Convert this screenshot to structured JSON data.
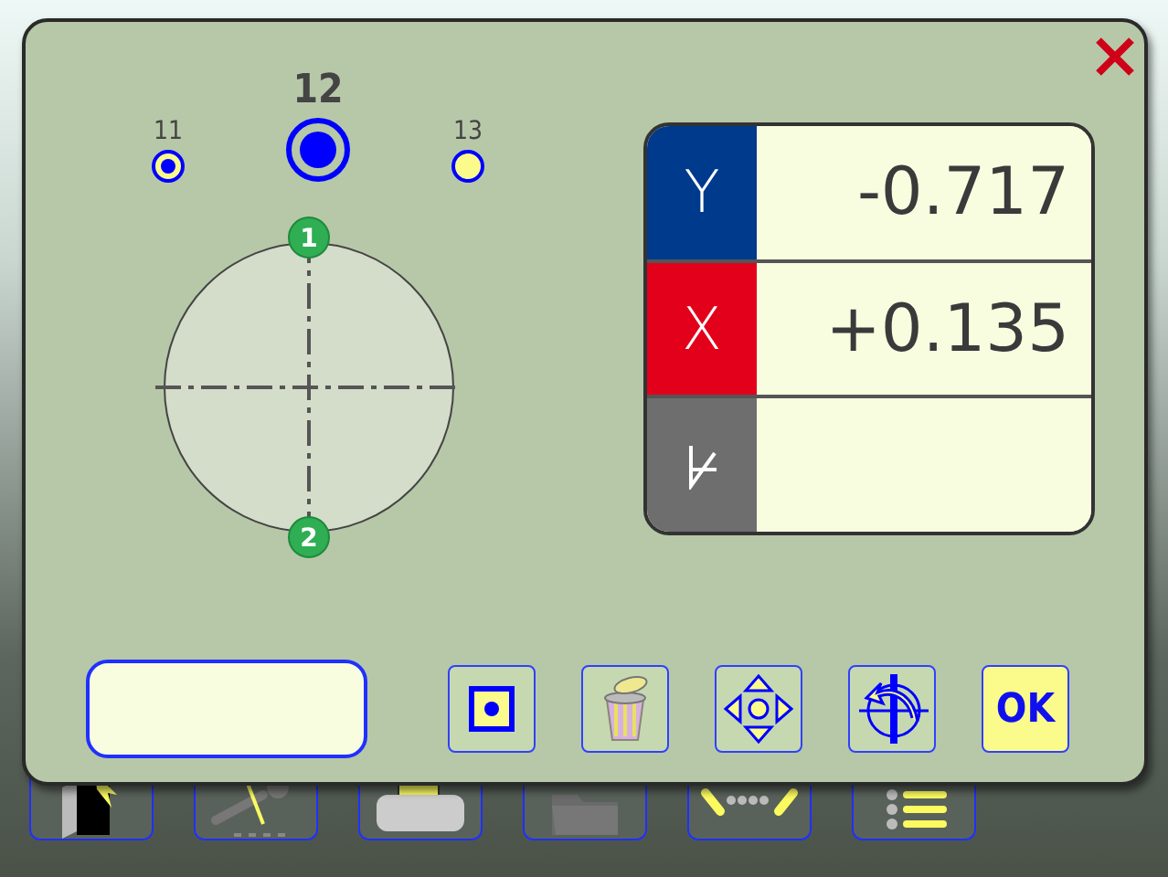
{
  "points": [
    {
      "label": "11",
      "selected": false,
      "measured": true
    },
    {
      "label": "12",
      "selected": true
    },
    {
      "label": "13",
      "selected": false,
      "measured": false
    }
  ],
  "diagram": {
    "markers": [
      "1",
      "2"
    ]
  },
  "readout": [
    {
      "kind": "axis",
      "label": "Y",
      "value": "-0.717",
      "color": "#003a8c"
    },
    {
      "kind": "axis",
      "label": "X",
      "value": "+0.135",
      "color": "#e2001a"
    },
    {
      "kind": "angle",
      "color": "#6e6e6e"
    }
  ],
  "buttons": [
    {
      "kind": "center"
    },
    {
      "kind": "delete"
    },
    {
      "kind": "move"
    },
    {
      "kind": "rotate"
    },
    {
      "kind": "ok",
      "label": "OK"
    }
  ],
  "taskbar": [
    {
      "kind": "exit"
    },
    {
      "kind": "tools"
    },
    {
      "kind": "printer"
    },
    {
      "kind": "folder"
    },
    {
      "kind": "dots"
    },
    {
      "kind": "list"
    }
  ]
}
